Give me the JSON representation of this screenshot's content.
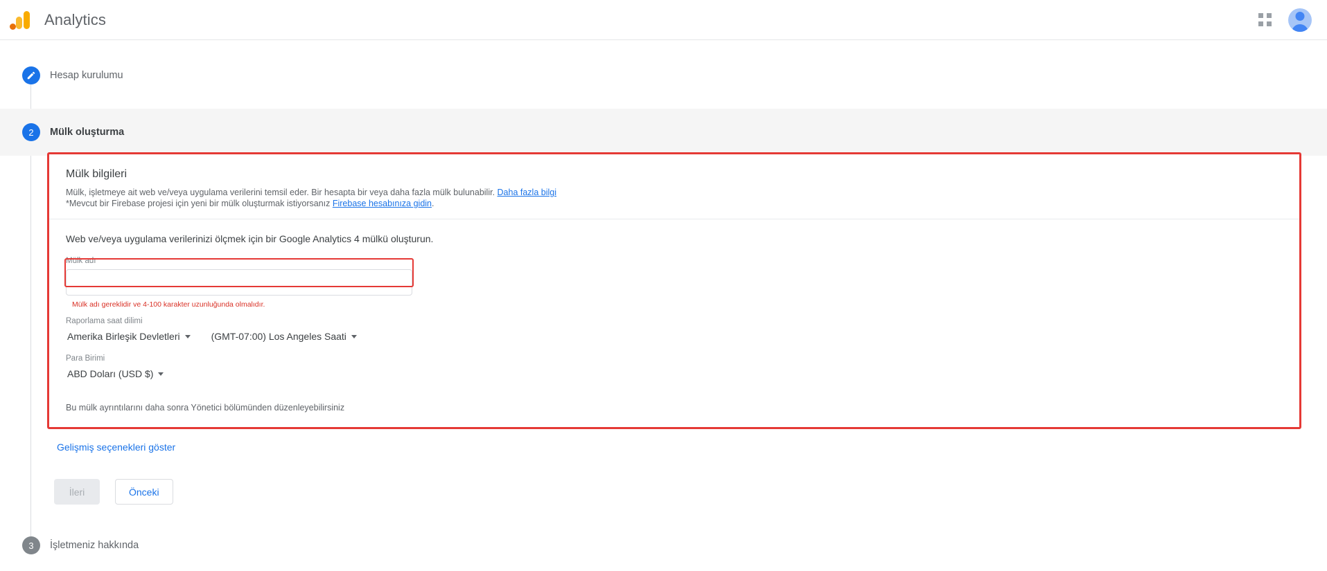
{
  "topbar": {
    "brand_title": "Analytics",
    "apps_icon": "apps-grid-icon",
    "avatar_icon": "account-avatar-icon"
  },
  "steps": [
    {
      "num": "1",
      "label": "Hesap kurulumu",
      "icon": "pencil-edit-icon",
      "state": "done"
    },
    {
      "num": "2",
      "label": "Mülk oluşturma",
      "state": "active"
    },
    {
      "num": "3",
      "label": "İşletmeniz hakkında",
      "state": "pending"
    }
  ],
  "card": {
    "title": "Mülk bilgileri",
    "desc_line1_text": "Mülk, işletmeye ait web ve/veya uygulama verilerini temsil eder. Bir hesapta bir veya daha fazla mülk bulunabilir. ",
    "desc_line1_link": "Daha fazla bilgi",
    "desc_line2_prefix": "*Mevcut bir Firebase projesi için yeni bir mülk oluşturmak istiyorsanız ",
    "desc_line2_link": "Firebase hesabınıza gidin",
    "desc_line2_suffix": ".",
    "measure_line": "Web ve/veya uygulama verilerinizi ölçmek için bir Google Analytics 4 mülkü oluşturun.",
    "property_name_label": "Mülk adı",
    "property_name_value": "",
    "property_name_placeholder": "",
    "property_name_error": "Mülk adı gereklidir ve 4-100 karakter uzunluğunda olmalıdır.",
    "timezone_group_label": "Raporlama saat dilimi",
    "timezone_country": "Amerika Birleşik Devletleri",
    "timezone_zone": "(GMT-07:00) Los Angeles Saati",
    "currency_group_label": "Para Birimi",
    "currency_value": "ABD Doları (USD $)",
    "footer_note": "Bu mülk ayrıntılarını daha sonra Yönetici bölümünden düzenleyebilirsiniz"
  },
  "footer": {
    "advanced_link": "Gelişmiş seçenekleri göster",
    "next_button": "İleri",
    "prev_button": "Önceki"
  },
  "colors": {
    "accent_blue": "#1a73e8",
    "error_red": "#d93025",
    "annotation_red": "#e53935",
    "logo_orange": "#f9ab00"
  }
}
